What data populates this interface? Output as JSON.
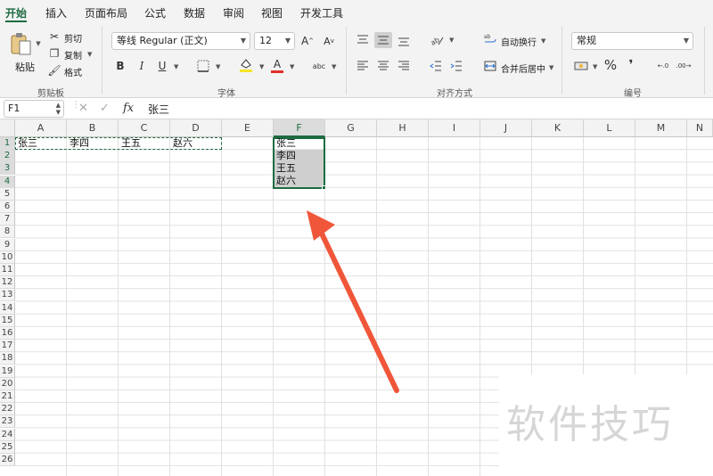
{
  "tabs": [
    "开始",
    "插入",
    "页面布局",
    "公式",
    "数据",
    "审阅",
    "视图",
    "开发工具"
  ],
  "clipboard": {
    "paste": "粘贴",
    "cut": "剪切",
    "copy": "复制",
    "format_painter": "格式",
    "group": "剪贴板"
  },
  "font": {
    "name": "等线 Regular (正文)",
    "size": "12",
    "bold": "B",
    "italic": "I",
    "underline": "U",
    "grow": "A",
    "shrink": "A",
    "font_color": "A",
    "phonetic": "abc",
    "group": "字体"
  },
  "alignment": {
    "wrap": "自动换行",
    "merge": "合并后居中",
    "group": "对齐方式"
  },
  "number": {
    "format": "常规",
    "percent": "%",
    "comma": "❜",
    "group": "编号"
  },
  "formula_bar": {
    "name_box": "F1",
    "fx": "fx",
    "content": "张三"
  },
  "columns": [
    "A",
    "B",
    "C",
    "D",
    "E",
    "F",
    "G",
    "H",
    "I",
    "J",
    "K",
    "L",
    "M",
    "N"
  ],
  "rows": [
    "1",
    "2",
    "3",
    "4",
    "5",
    "6",
    "7",
    "8",
    "9",
    "10",
    "11",
    "12",
    "13",
    "14",
    "15",
    "16",
    "17",
    "18",
    "19",
    "20",
    "21",
    "22",
    "23",
    "24",
    "25",
    "26"
  ],
  "row1": {
    "A": "张三",
    "B": "李四",
    "C": "王五",
    "D": "赵六"
  },
  "colF": [
    "张三",
    "李四",
    "王五",
    "赵六"
  ],
  "watermark": "软件技巧",
  "colors": {
    "accent": "#1d6b40",
    "arrow": "#f0563a",
    "font_color_bar": "#e0302a",
    "highlight_bar": "#f5e52a"
  }
}
